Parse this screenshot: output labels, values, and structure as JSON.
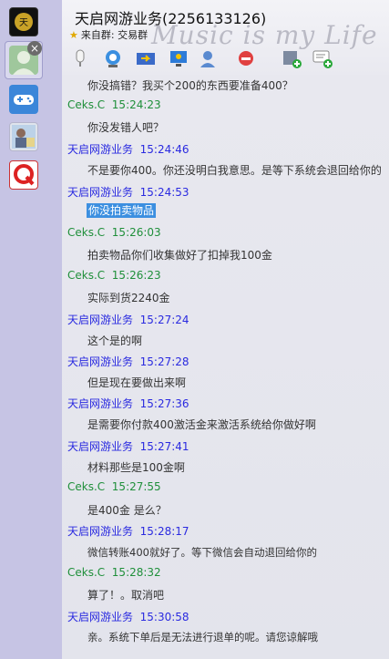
{
  "window": {
    "title": "天启网游业务(2256133126)",
    "group_prefix": "来自群:",
    "group_name": "交易群",
    "deco_text": "Music is my Life"
  },
  "sidebar": {
    "items": [
      {
        "name": "app-logo",
        "icon": "logo-icon"
      },
      {
        "name": "current-chat",
        "icon": "contact-avatar-icon"
      },
      {
        "name": "games",
        "icon": "gamepad-icon"
      },
      {
        "name": "contact-2",
        "icon": "contact-avatar-icon"
      },
      {
        "name": "app-q",
        "icon": "q-logo-icon"
      }
    ],
    "close_label": "×"
  },
  "toolbar": {
    "icons": [
      "mic-icon",
      "camera-icon",
      "file-transfer-icon",
      "remote-desktop-icon",
      "block-icon",
      "add-contact-icon",
      "message-add-icon"
    ]
  },
  "messages": [
    {
      "who": "",
      "time": "",
      "text": "你没搞错？我买个200的东西要准备400？",
      "highlight": false
    },
    {
      "who": "Ceks.C",
      "time": "15:24:23",
      "text": "你没发错人吧？",
      "side": "other"
    },
    {
      "who": "天启网游业务",
      "time": "15:24:46",
      "text": "不是要你400。你还没明白我意思。是等下系统会退回给你的",
      "side": "self"
    },
    {
      "who": "天启网游业务",
      "time": "15:24:53",
      "text": "你没拍卖物品",
      "side": "self",
      "highlight": true
    },
    {
      "who": "Ceks.C",
      "time": "15:26:03",
      "text": "拍卖物品你们收集做好了扣掉我100金",
      "side": "other"
    },
    {
      "who": "Ceks.C",
      "time": "15:26:23",
      "text": "实际到货2240金",
      "side": "other"
    },
    {
      "who": "天启网游业务",
      "time": "15:27:24",
      "text": "这个是的啊",
      "side": "self"
    },
    {
      "who": "天启网游业务",
      "time": "15:27:28",
      "text": "但是现在要做出来啊",
      "side": "self"
    },
    {
      "who": "天启网游业务",
      "time": "15:27:36",
      "text": "是需要你付款400激活金来激活系统给你做好啊",
      "side": "self"
    },
    {
      "who": "天启网游业务",
      "time": "15:27:41",
      "text": "材料那些是100金啊",
      "side": "self"
    },
    {
      "who": "Ceks.C",
      "time": "15:27:55",
      "text": "是400金  是么？",
      "side": "other"
    },
    {
      "who": "天启网游业务",
      "time": "15:28:17",
      "text": "微信转账400就好了。等下微信会自动退回给你的",
      "side": "self"
    },
    {
      "who": "Ceks.C",
      "time": "15:28:32",
      "text": "算了！。取消吧",
      "side": "other"
    },
    {
      "who": "天启网游业务",
      "time": "15:30:58",
      "text": "亲。系统下单后是无法进行退单的呢。请您谅解哦",
      "side": "self"
    }
  ]
}
